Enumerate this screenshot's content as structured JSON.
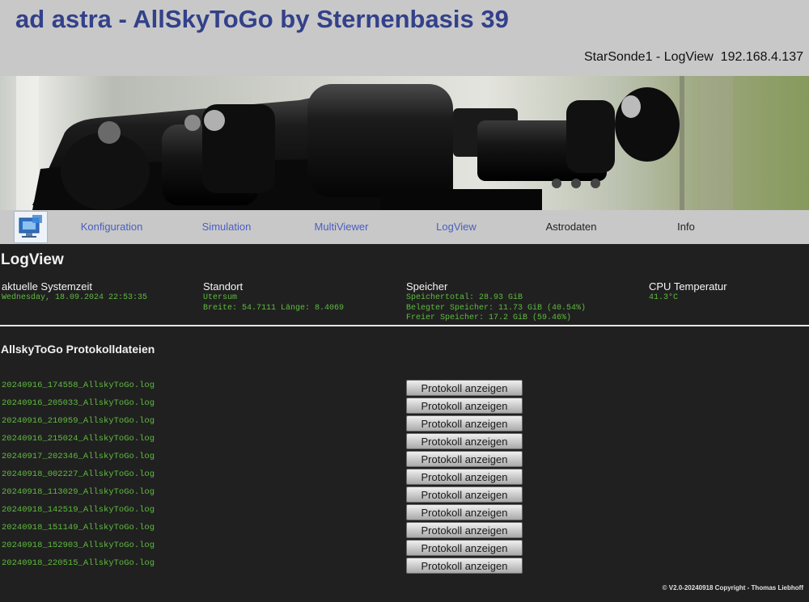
{
  "header": {
    "title": "ad astra - AllSkyToGo by Sternenbasis 39",
    "subtitle": "StarSonde1 - LogView  192.168.4.137"
  },
  "nav": {
    "items": [
      {
        "label": "Konfiguration"
      },
      {
        "label": "Simulation"
      },
      {
        "label": "MultiViewer"
      },
      {
        "label": "LogView"
      },
      {
        "label": "Astrodaten"
      },
      {
        "label": "Info"
      }
    ]
  },
  "page_title": "LogView",
  "system_info": {
    "time": {
      "heading": "aktuelle Systemzeit",
      "value": "Wednesday, 18.09.2024 22:53:35"
    },
    "location": {
      "heading": "Standort",
      "name": "Utersum",
      "coords": "Breite: 54.7111 Länge: 8.4069"
    },
    "storage": {
      "heading": "Speicher",
      "total": "Speichertotal: 28.93 GiB",
      "used": "Belegter Speicher: 11.73 GiB (40.54%)",
      "free": "Freier Speicher: 17.2 GiB (59.46%)"
    },
    "cpu": {
      "heading": "CPU Temperatur",
      "value": "41.3°C"
    }
  },
  "logs": {
    "title": "AllskyToGo Protokolldateien",
    "button_label": "Protokoll anzeigen",
    "files": [
      "20240916_174558_AllskyToGo.log",
      "20240916_205033_AllskyToGo.log",
      "20240916_210959_AllskyToGo.log",
      "20240916_215024_AllskyToGo.log",
      "20240917_202346_AllskyToGo.log",
      "20240918_002227_AllskyToGo.log",
      "20240918_113029_AllskyToGo.log",
      "20240918_142519_AllskyToGo.log",
      "20240918_151149_AllskyToGo.log",
      "20240918_152903_AllskyToGo.log",
      "20240918_220515_AllskyToGo.log"
    ]
  },
  "footer": "© V2.0-20240918 Copyright - Thomas Liebhoff",
  "colors": {
    "title_blue": "#33418a",
    "nav_link": "#4a5ec0",
    "header_bg": "#c8c8c8",
    "page_bg": "#202020",
    "log_green": "#5fbb3f"
  }
}
